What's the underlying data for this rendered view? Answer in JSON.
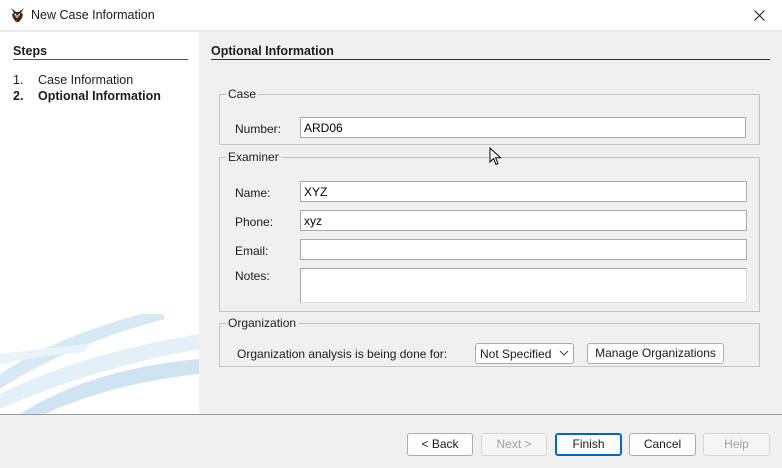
{
  "window": {
    "title": "New Case Information",
    "icon": "app-dog-icon",
    "close_icon": "close-icon"
  },
  "sidebar": {
    "heading": "Steps",
    "steps": [
      {
        "number": "1.",
        "label": "Case Information",
        "current": false
      },
      {
        "number": "2.",
        "label": "Optional Information",
        "current": true
      }
    ]
  },
  "main": {
    "title": "Optional Information",
    "case": {
      "label": "Case",
      "number_label": "Number:",
      "number_value": "ARD06"
    },
    "examiner": {
      "label": "Examiner",
      "name_label": "Name:",
      "name_value": "XYZ",
      "phone_label": "Phone:",
      "phone_value": "xyz",
      "email_label": "Email:",
      "email_value": "",
      "notes_label": "Notes:",
      "notes_value": ""
    },
    "organization": {
      "label": "Organization",
      "prompt": "Organization analysis is being done for:",
      "selected": "Not Specified",
      "manage_label": "Manage Organizations"
    }
  },
  "buttons": {
    "back": "< Back",
    "next": "Next >",
    "finish": "Finish",
    "cancel": "Cancel",
    "help": "Help"
  },
  "colors": {
    "accent": "#0067c0",
    "panel": "#f0f0f0",
    "sidebar": "#ffffff"
  }
}
